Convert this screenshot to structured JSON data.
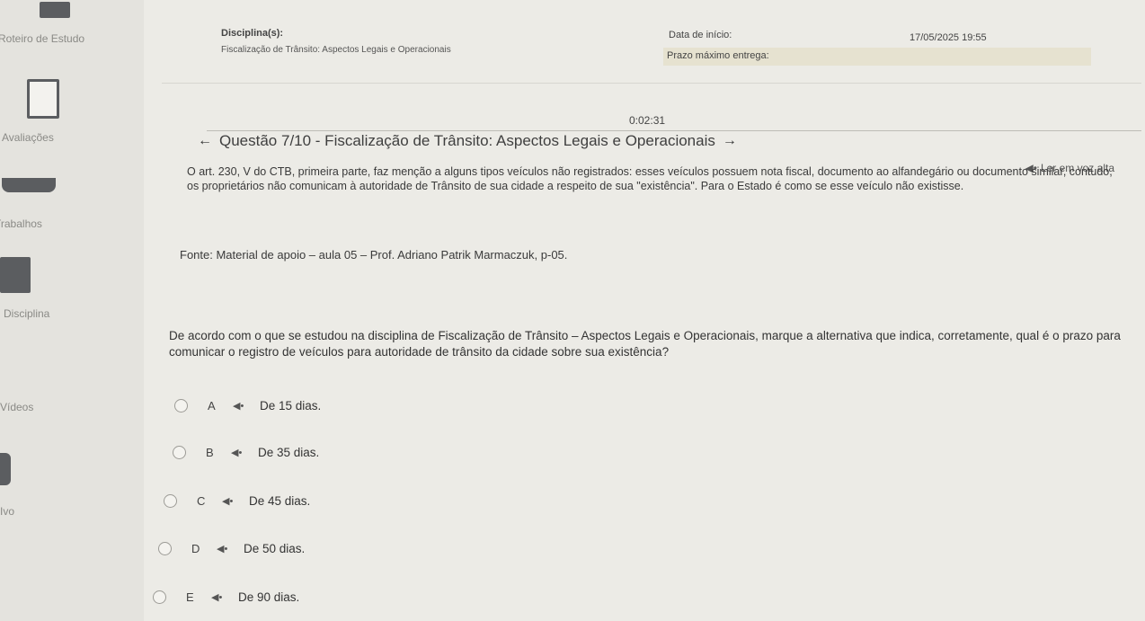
{
  "sidebar": {
    "items": [
      {
        "label": "Roteiro de Estudo",
        "icon": "book-icon"
      },
      {
        "label": "Avaliações",
        "icon": "clipboard-icon"
      },
      {
        "label": "Trabalhos",
        "icon": "tray-icon"
      },
      {
        "label": "Disciplina",
        "icon": "folder-icon"
      },
      {
        "label": "Vídeos",
        "icon": "video-icon"
      },
      {
        "label": "Ivo",
        "icon": "archive-icon"
      }
    ]
  },
  "header": {
    "discipline_label": "Disciplina(s):",
    "discipline_value": "Fiscalização de Trânsito: Aspectos Legais e Operacionais",
    "start_label": "Data de início:",
    "start_value": "17/05/2025 19:55",
    "deadline_label": "Prazo máximo entrega:",
    "deadline_value": ""
  },
  "timer": "0:02:31",
  "question": {
    "title": "Questão 7/10 - Fiscalização de Trânsito: Aspectos Legais e Operacionais",
    "read_aloud": "Ler em voz alta",
    "paragraph1": "O art. 230, V do CTB, primeira parte, faz menção a alguns tipos veículos não registrados: esses veículos possuem nota fiscal, documento ao alfandegário ou documento similar, contudo, os proprietários não comunicam à autoridade de Trânsito de sua cidade a respeito de sua \"existência\". Para o Estado é como se esse veículo não existisse.",
    "source": "Fonte: Material de apoio – aula 05 – Prof. Adriano Patrik Marmaczuk, p-05.",
    "prompt": "De acordo com o que se estudou na disciplina de Fiscalização de Trânsito – Aspectos Legais e Operacionais, marque a alternativa que indica, corretamente, qual é o prazo para comunicar o registro de veículos para autoridade de trânsito da cidade sobre sua existência?",
    "options": [
      {
        "letter": "A",
        "text": "De 15 dias."
      },
      {
        "letter": "B",
        "text": "De 35 dias."
      },
      {
        "letter": "C",
        "text": "De 45 dias."
      },
      {
        "letter": "D",
        "text": "De 50 dias."
      },
      {
        "letter": "E",
        "text": "De 90 dias."
      }
    ]
  },
  "icons": {
    "speaker": "speaker-icon",
    "prev": "arrow-left-icon",
    "next": "arrow-right-icon"
  },
  "colors": {
    "background": "#ecebe6",
    "sidebar": "#e4e3de",
    "deadline_field": "#e6e2d0"
  }
}
